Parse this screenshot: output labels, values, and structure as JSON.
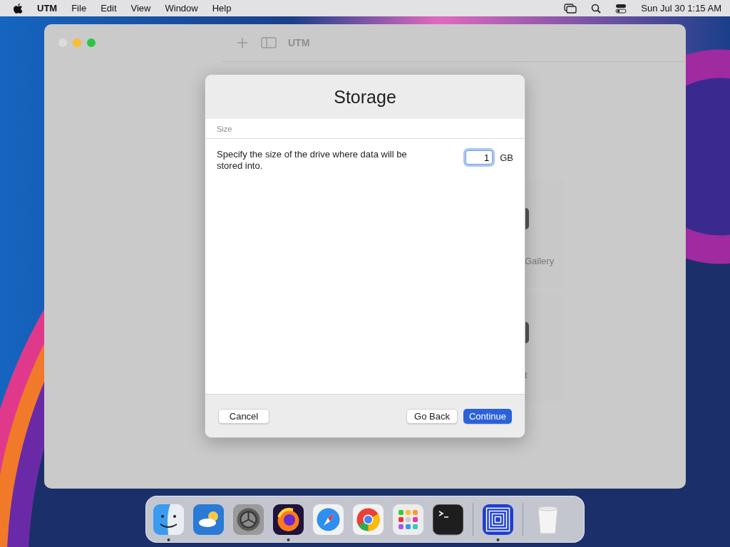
{
  "menu_bar": {
    "app_name": "UTM",
    "menus": [
      "File",
      "Edit",
      "View",
      "Window",
      "Help"
    ],
    "clock": "Sun Jul 30 1:15 AM"
  },
  "window": {
    "traffic_lights": [
      {
        "color": "#dcdcdc"
      },
      {
        "color": "#febc2e"
      },
      {
        "color": "#28c840"
      }
    ],
    "title": "UTM",
    "cards": [
      {
        "label": "Gallery"
      },
      {
        "label": "t"
      }
    ]
  },
  "dialog": {
    "title": "Storage",
    "section": "Size",
    "description": "Specify the size of the drive where data will be stored into.",
    "size_field": {
      "value": "1",
      "focused": true
    },
    "unit": "GB",
    "buttons": [
      {
        "label": "Cancel",
        "kind": "secondary"
      },
      {
        "label": "Go Back",
        "kind": "secondary"
      },
      {
        "label": "Continue",
        "kind": "primary"
      }
    ]
  },
  "dock": {
    "apps": [
      {
        "kind": "finder",
        "running": true
      },
      {
        "kind": "weather",
        "running": false
      },
      {
        "kind": "settings",
        "running": false
      },
      {
        "kind": "firefox",
        "running": true
      },
      {
        "kind": "safari",
        "running": false
      },
      {
        "kind": "chrome",
        "running": false
      },
      {
        "kind": "launchpad",
        "running": false
      },
      {
        "kind": "terminal",
        "running": false
      }
    ],
    "documents": [
      {
        "kind": "utm",
        "running": true
      }
    ]
  }
}
